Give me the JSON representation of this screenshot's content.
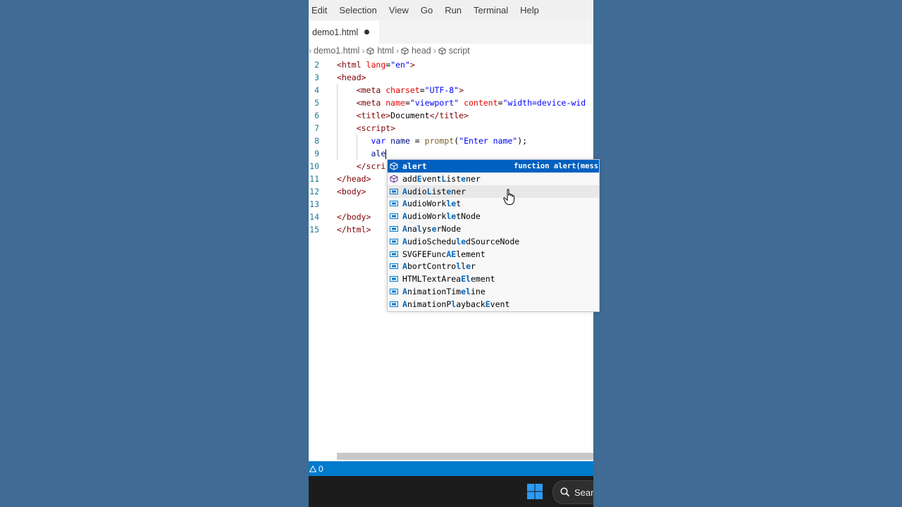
{
  "menubar": {
    "items": [
      "Edit",
      "Selection",
      "View",
      "Go",
      "Run",
      "Terminal",
      "Help"
    ]
  },
  "tab": {
    "label": "demo1.html"
  },
  "breadcrumb": [
    "demo1.html",
    "html",
    "head",
    "script"
  ],
  "editor": {
    "lines": [
      {
        "n": "2",
        "tokens": [
          [
            "t-tag",
            "<html "
          ],
          [
            "t-attr",
            "lang"
          ],
          [
            "t-txt",
            "="
          ],
          [
            "t-str",
            "\"en\""
          ],
          [
            "t-tag",
            ">"
          ]
        ]
      },
      {
        "n": "3",
        "tokens": [
          [
            "t-tag",
            "<head>"
          ]
        ]
      },
      {
        "n": "4",
        "tokens": [
          [
            "t-txt",
            "    "
          ],
          [
            "t-tag",
            "<meta "
          ],
          [
            "t-attr",
            "charset"
          ],
          [
            "t-txt",
            "="
          ],
          [
            "t-str",
            "\"UTF-8\""
          ],
          [
            "t-tag",
            ">"
          ]
        ]
      },
      {
        "n": "5",
        "tokens": [
          [
            "t-txt",
            "    "
          ],
          [
            "t-tag",
            "<meta "
          ],
          [
            "t-attr",
            "name"
          ],
          [
            "t-txt",
            "="
          ],
          [
            "t-str",
            "\"viewport\" "
          ],
          [
            "t-attr",
            "content"
          ],
          [
            "t-txt",
            "="
          ],
          [
            "t-str",
            "\"width=device-wid"
          ]
        ]
      },
      {
        "n": "6",
        "tokens": [
          [
            "t-txt",
            "    "
          ],
          [
            "t-tag",
            "<title>"
          ],
          [
            "t-txt",
            "Document"
          ],
          [
            "t-tag",
            "</title>"
          ]
        ]
      },
      {
        "n": "7",
        "tokens": [
          [
            "t-txt",
            "    "
          ],
          [
            "t-tag",
            "<script>"
          ]
        ]
      },
      {
        "n": "8",
        "tokens": [
          [
            "t-txt",
            "       "
          ],
          [
            "t-kw",
            "var "
          ],
          [
            "t-var",
            "name"
          ],
          [
            "t-plain",
            " = "
          ],
          [
            "t-fn",
            "prompt"
          ],
          [
            "t-plain",
            "("
          ],
          [
            "t-str",
            "\"Enter name\""
          ],
          [
            "t-plain",
            ");"
          ]
        ]
      },
      {
        "n": "9",
        "tokens": [
          [
            "t-txt",
            "       "
          ],
          [
            "t-var",
            "ale"
          ]
        ]
      },
      {
        "n": "10",
        "tokens": [
          [
            "t-txt",
            "    "
          ],
          [
            "t-tag",
            "</scri"
          ]
        ]
      },
      {
        "n": "11",
        "tokens": [
          [
            "t-tag",
            "</head>"
          ]
        ]
      },
      {
        "n": "12",
        "tokens": [
          [
            "t-tag",
            "<body>"
          ]
        ]
      },
      {
        "n": "13",
        "tokens": []
      },
      {
        "n": "14",
        "tokens": [
          [
            "t-tag",
            "</body>"
          ]
        ]
      },
      {
        "n": "15",
        "tokens": [
          [
            "t-tag",
            "</html>"
          ]
        ]
      }
    ]
  },
  "suggest": {
    "items": [
      {
        "kind": "method",
        "parts": [
          [
            "hl",
            "ale"
          ],
          [
            "",
            "rt"
          ]
        ],
        "detail": "function alert(mess",
        "state": "selected"
      },
      {
        "kind": "method",
        "parts": [
          [
            "",
            "add"
          ],
          [
            "hl",
            "E"
          ],
          [
            "",
            "vent"
          ],
          [
            "hl",
            "L"
          ],
          [
            "",
            "ist"
          ],
          [
            "hl",
            "e"
          ],
          [
            "",
            "ner"
          ]
        ],
        "detail": "",
        "state": ""
      },
      {
        "kind": "variable",
        "parts": [
          [
            "hl",
            "A"
          ],
          [
            "",
            "udio"
          ],
          [
            "hl",
            "L"
          ],
          [
            "",
            "ist"
          ],
          [
            "hl",
            "e"
          ],
          [
            "",
            "ner"
          ]
        ],
        "detail": "",
        "state": "hover"
      },
      {
        "kind": "variable",
        "parts": [
          [
            "hl",
            "A"
          ],
          [
            "",
            "udioWork"
          ],
          [
            "hl",
            "le"
          ],
          [
            "",
            "t"
          ]
        ],
        "detail": "",
        "state": ""
      },
      {
        "kind": "variable",
        "parts": [
          [
            "hl",
            "A"
          ],
          [
            "",
            "udioWork"
          ],
          [
            "hl",
            "le"
          ],
          [
            "",
            "tNode"
          ]
        ],
        "detail": "",
        "state": ""
      },
      {
        "kind": "variable",
        "parts": [
          [
            "hl",
            "A"
          ],
          [
            "",
            "na"
          ],
          [
            "hl",
            "l"
          ],
          [
            "",
            "ys"
          ],
          [
            "hl",
            "e"
          ],
          [
            "",
            "rNode"
          ]
        ],
        "detail": "",
        "state": ""
      },
      {
        "kind": "variable",
        "parts": [
          [
            "hl",
            "A"
          ],
          [
            "",
            "udioSchedu"
          ],
          [
            "hl",
            "le"
          ],
          [
            "",
            "dSourceNode"
          ]
        ],
        "detail": "",
        "state": ""
      },
      {
        "kind": "variable",
        "parts": [
          [
            "",
            "SVGFEFunc"
          ],
          [
            "hl",
            "A"
          ],
          [
            "hl",
            "E"
          ],
          [
            "",
            "lement"
          ]
        ],
        "detail": "",
        "state": ""
      },
      {
        "kind": "variable",
        "parts": [
          [
            "hl",
            "A"
          ],
          [
            "",
            "bortContro"
          ],
          [
            "hl",
            "l"
          ],
          [
            "",
            "l"
          ],
          [
            "hl",
            "e"
          ],
          [
            "",
            "r"
          ]
        ],
        "detail": "",
        "state": ""
      },
      {
        "kind": "variable",
        "parts": [
          [
            "",
            "HTMLTextArea"
          ],
          [
            "hl",
            "E"
          ],
          [
            "hl",
            "l"
          ],
          [
            "",
            "ement"
          ]
        ],
        "detail": "",
        "state": ""
      },
      {
        "kind": "variable",
        "parts": [
          [
            "hl",
            "A"
          ],
          [
            "",
            "nimationTim"
          ],
          [
            "hl",
            "el"
          ],
          [
            "",
            "ine"
          ]
        ],
        "detail": "",
        "state": ""
      },
      {
        "kind": "variable",
        "parts": [
          [
            "hl",
            "A"
          ],
          [
            "",
            "nimationP"
          ],
          [
            "hl",
            "l"
          ],
          [
            "",
            "ayback"
          ],
          [
            "hl",
            "E"
          ],
          [
            "",
            "vent"
          ]
        ],
        "detail": "",
        "state": ""
      }
    ]
  },
  "status": {
    "problems": "0"
  },
  "taskbar": {
    "search_label": "Sear"
  },
  "colors": {
    "accent": "#007acc",
    "selected": "#0060c0",
    "desktop": "#3f6b94"
  }
}
